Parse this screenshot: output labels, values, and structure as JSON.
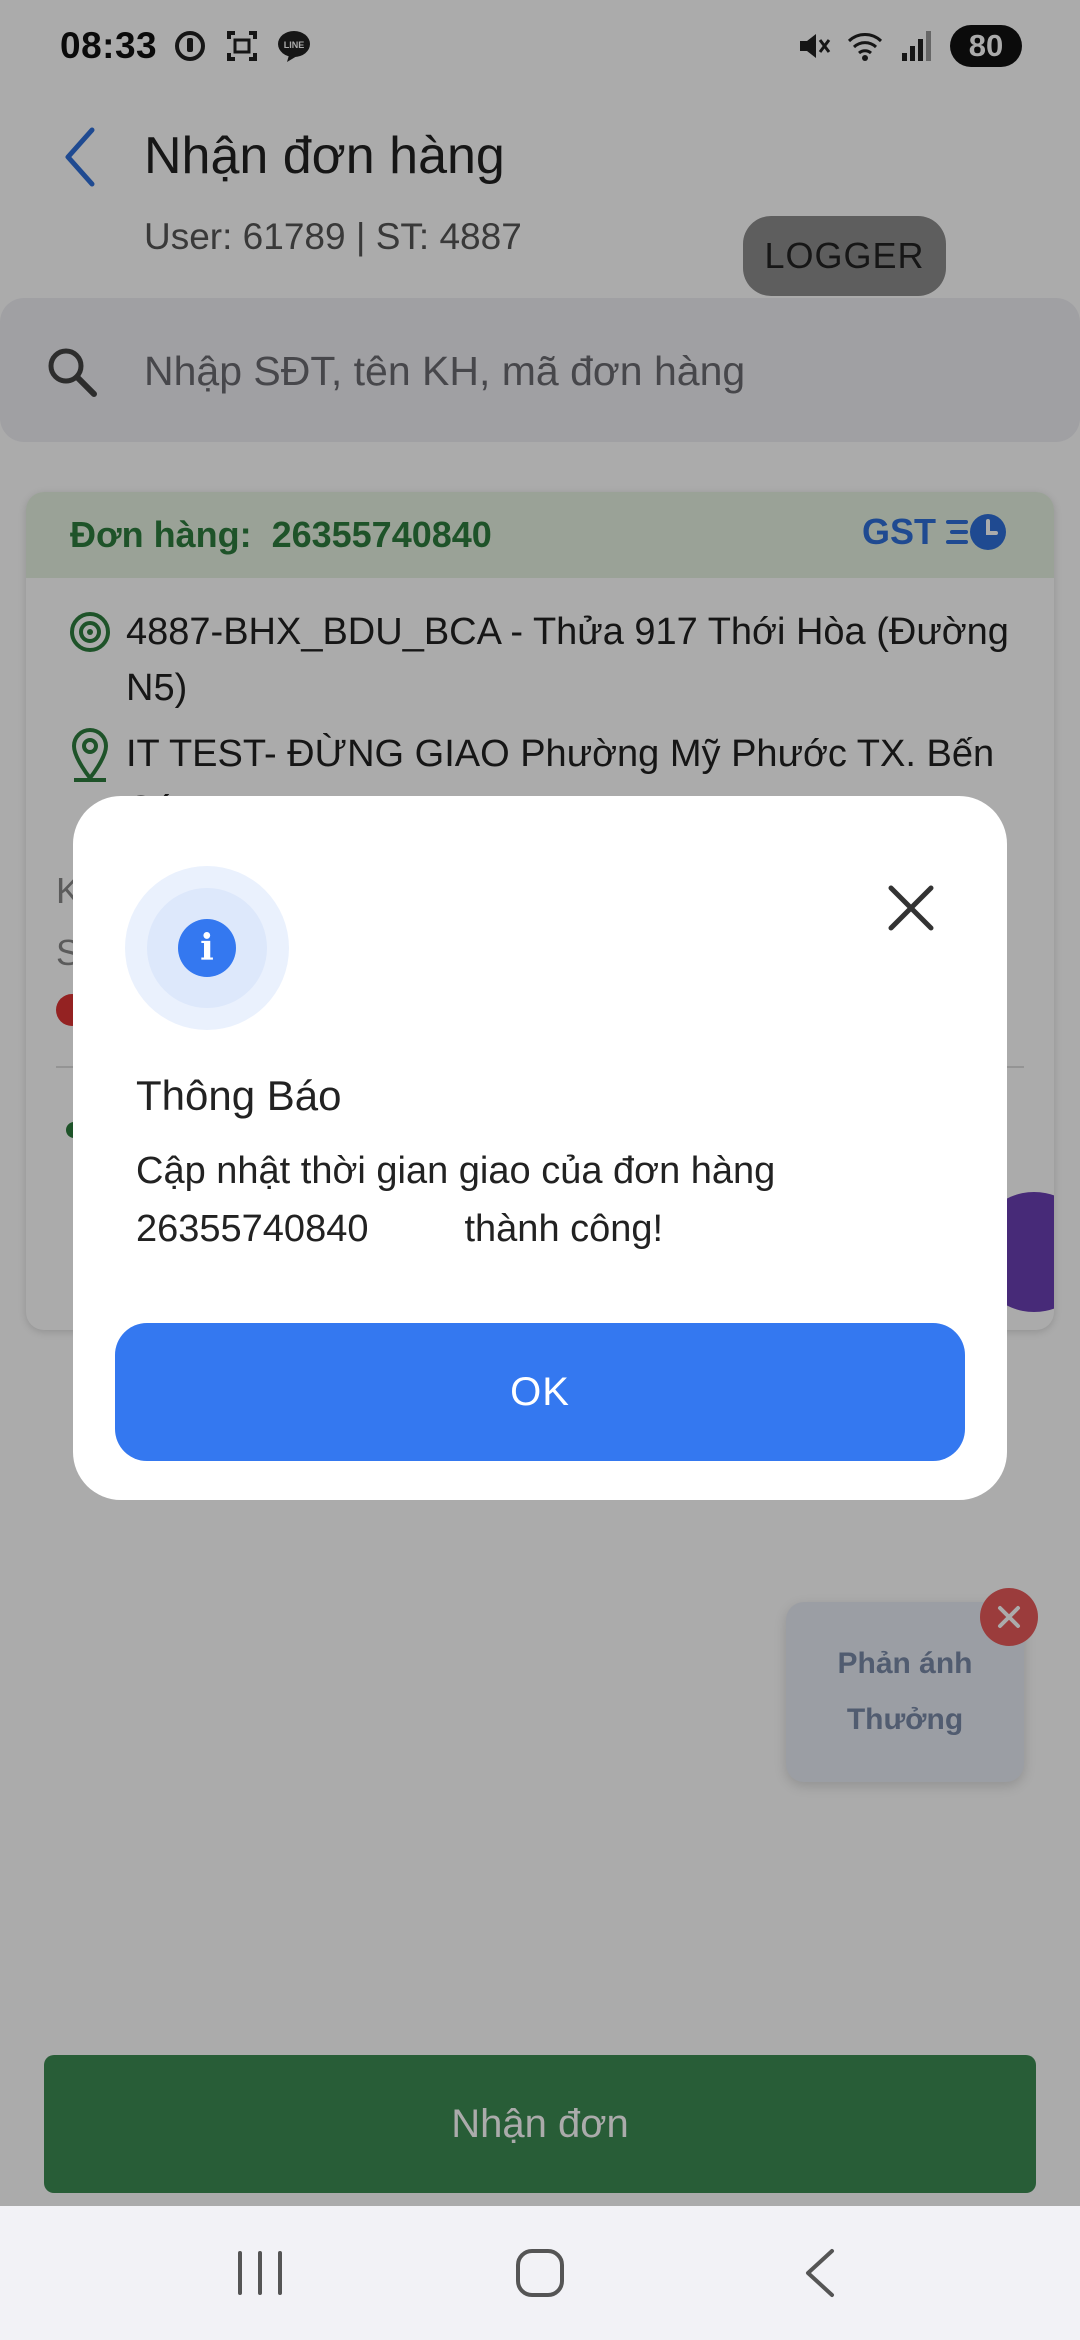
{
  "status_bar": {
    "time": "08:33",
    "battery": "80",
    "icons": [
      "alarm-icon",
      "screenshot-icon",
      "line-app-icon",
      "mute-icon",
      "wifi-icon",
      "signal-icon"
    ]
  },
  "header": {
    "title": "Nhận đơn hàng",
    "user_info": "User: 61789 | ST: 4887",
    "logger_label": "LOGGER"
  },
  "search": {
    "placeholder": "Nhập SĐT, tên KH, mã đơn hàng"
  },
  "order": {
    "label": "Đơn hàng:",
    "number": "26355740840",
    "badge": "GST",
    "pickup_address": "4887-BHX_BDU_BCA - Thửa 917 Thới Hòa (Đường N5)",
    "delivery_address": "IT TEST- ĐỪNG GIAO Phường Mỹ Phước TX. Bến Cát",
    "partial_line_1": "K",
    "partial_line_2": "S"
  },
  "floating_widget": {
    "line1": "Phản ánh",
    "line2": "Thưởng"
  },
  "bottom_button": {
    "label": "Nhận đơn"
  },
  "dialog": {
    "title": "Thông Báo",
    "message_line1": "Cập nhật thời gian giao của đơn hàng",
    "message_number": "26355740840",
    "message_suffix": "thành công!",
    "ok_label": "OK"
  },
  "colors": {
    "accent_blue": "#3478f0",
    "green": "#3d8b52",
    "order_header_bg": "#e6f2e1"
  }
}
